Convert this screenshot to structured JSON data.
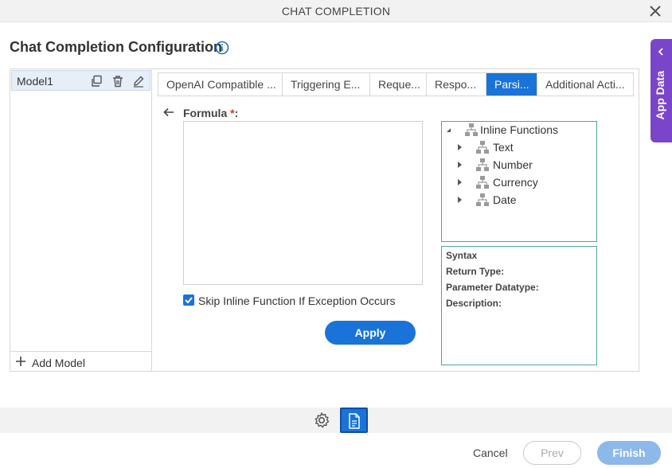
{
  "window": {
    "title": "CHAT COMPLETION"
  },
  "page": {
    "heading": "Chat Completion Configuration"
  },
  "side_tab": {
    "label": "App Data"
  },
  "models": {
    "items": [
      {
        "name": "Model1"
      }
    ],
    "add_label": "Add Model"
  },
  "tabs": [
    {
      "label": "OpenAI Compatible ...",
      "active": false
    },
    {
      "label": "Triggering E...",
      "active": false
    },
    {
      "label": "Reque...",
      "active": false
    },
    {
      "label": "Respo...",
      "active": false
    },
    {
      "label": "Parsi...",
      "active": true
    },
    {
      "label": "Additional Acti...",
      "active": false
    }
  ],
  "formula": {
    "label": "Formula",
    "required_mark": "*",
    "colon": ":",
    "value": ""
  },
  "skip_exception": {
    "label": "Skip Inline Function If Exception Occurs",
    "checked": true
  },
  "apply_label": "Apply",
  "tree": {
    "root": "Inline Functions",
    "children": [
      "Text",
      "Number",
      "Currency",
      "Date"
    ]
  },
  "syntax_panel": {
    "syntax": "Syntax",
    "return_type": "Return Type:",
    "parameter_datatype": "Parameter Datatype:",
    "description": "Description:"
  },
  "footer": {
    "cancel": "Cancel",
    "prev": "Prev",
    "finish": "Finish"
  },
  "colors": {
    "accent": "#1a73d9",
    "app_data": "#7b45c9",
    "required": "#d93025",
    "panel_border": "#4aa7a0"
  }
}
